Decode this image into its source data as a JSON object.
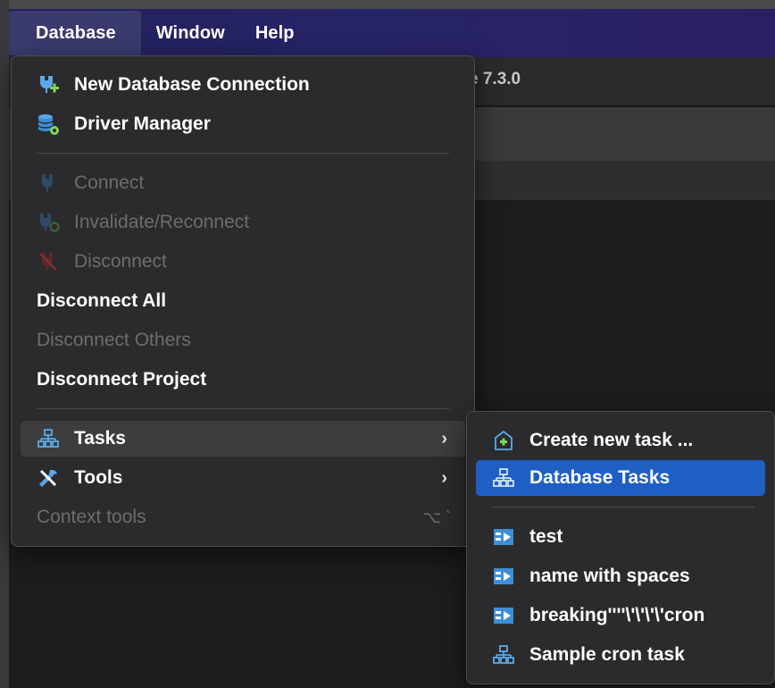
{
  "menubar": {
    "items": [
      "Database",
      "Window",
      "Help"
    ]
  },
  "app": {
    "title_fragment": "e 7.3.0"
  },
  "database_menu": {
    "items": [
      {
        "label": "New Database Connection",
        "icon": "plug-plus-icon",
        "enabled": true
      },
      {
        "label": "Driver Manager",
        "icon": "database-gear-icon",
        "enabled": true
      },
      {
        "label": "Connect",
        "icon": "plug-icon",
        "enabled": false
      },
      {
        "label": "Invalidate/Reconnect",
        "icon": "plug-refresh-icon",
        "enabled": false
      },
      {
        "label": "Disconnect",
        "icon": "plug-disconnect-icon",
        "enabled": false
      },
      {
        "label": "Disconnect All",
        "enabled": true
      },
      {
        "label": "Disconnect Others",
        "enabled": false
      },
      {
        "label": "Disconnect Project",
        "enabled": true
      },
      {
        "label": "Tasks",
        "icon": "tasks-icon",
        "enabled": true,
        "submenu": true
      },
      {
        "label": "Tools",
        "icon": "tools-icon",
        "enabled": true,
        "submenu": true
      },
      {
        "label": "Context tools",
        "enabled": false,
        "shortcut": "⌥ `"
      }
    ]
  },
  "tasks_submenu": {
    "items": [
      {
        "label": "Create new task ...",
        "icon": "create-task-icon"
      },
      {
        "label": "Database Tasks",
        "icon": "tasks-icon",
        "selected": true
      },
      {
        "label": "test",
        "icon": "task-item-icon"
      },
      {
        "label": "name with spaces",
        "icon": "task-item-icon"
      },
      {
        "label": "breaking''''\\'\\'\\'\\'cron",
        "icon": "task-item-icon"
      },
      {
        "label": "Sample cron task",
        "icon": "tasks-icon"
      }
    ]
  },
  "colors": {
    "menubar": "#262468",
    "menu_bg": "#2b2b2d",
    "selection": "#1f5fc4",
    "disabled_text": "#6d6d6f"
  }
}
